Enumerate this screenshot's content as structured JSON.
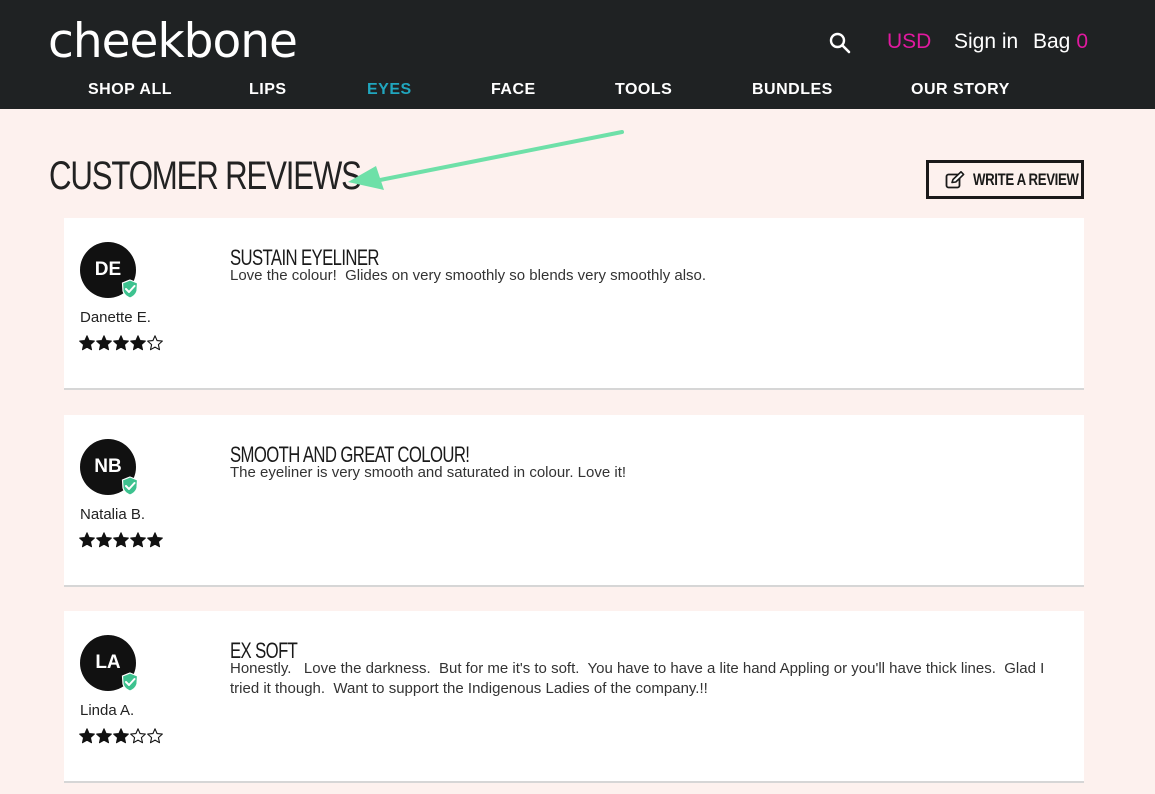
{
  "header": {
    "logo": "cheekbone",
    "currency": "USD",
    "sign_in": "Sign in",
    "bag_label": "Bag",
    "bag_count": "0",
    "nav": [
      {
        "label": "SHOP ALL",
        "active": false
      },
      {
        "label": "LIPS",
        "active": false
      },
      {
        "label": "EYES",
        "active": true
      },
      {
        "label": "FACE",
        "active": false
      },
      {
        "label": "TOOLS",
        "active": false
      },
      {
        "label": "BUNDLES",
        "active": false
      },
      {
        "label": "OUR STORY",
        "active": false
      }
    ]
  },
  "main": {
    "title": "CUSTOMER REVIEWS",
    "write_review_label": "WRITE A REVIEW"
  },
  "reviews": [
    {
      "initials": "DE",
      "name": "Danette E.",
      "rating": 4,
      "title": "SUSTAIN EYELINER",
      "body": "Love the colour!  Glides on very smoothly so blends very smoothly also."
    },
    {
      "initials": "NB",
      "name": "Natalia B.",
      "rating": 5,
      "title": "SMOOTH AND GREAT COLOUR!",
      "body": "The eyeliner is very smooth and saturated in colour. Love it!"
    },
    {
      "initials": "LA",
      "name": "Linda A.",
      "rating": 3,
      "title": "EX SOFT",
      "body": "Honestly.   Love the darkness.  But for me it's to soft.  You have to have a lite hand Appling or you'll have thick lines.  Glad I tried it though.  Want to support the Indigenous Ladies of the company.!!"
    }
  ],
  "colors": {
    "header_bg": "#1f2223",
    "accent_pink": "#e0199f",
    "active_nav": "#20a6be",
    "verified_badge": "#3dc28f",
    "annotation_arrow": "#6ee0a8",
    "page_bg": "#fdf1ee"
  },
  "icons": {
    "search": "search-icon",
    "pencil": "edit-icon",
    "verified": "verified-check-icon",
    "star_filled": "star-filled-icon",
    "star_empty": "star-empty-icon"
  }
}
